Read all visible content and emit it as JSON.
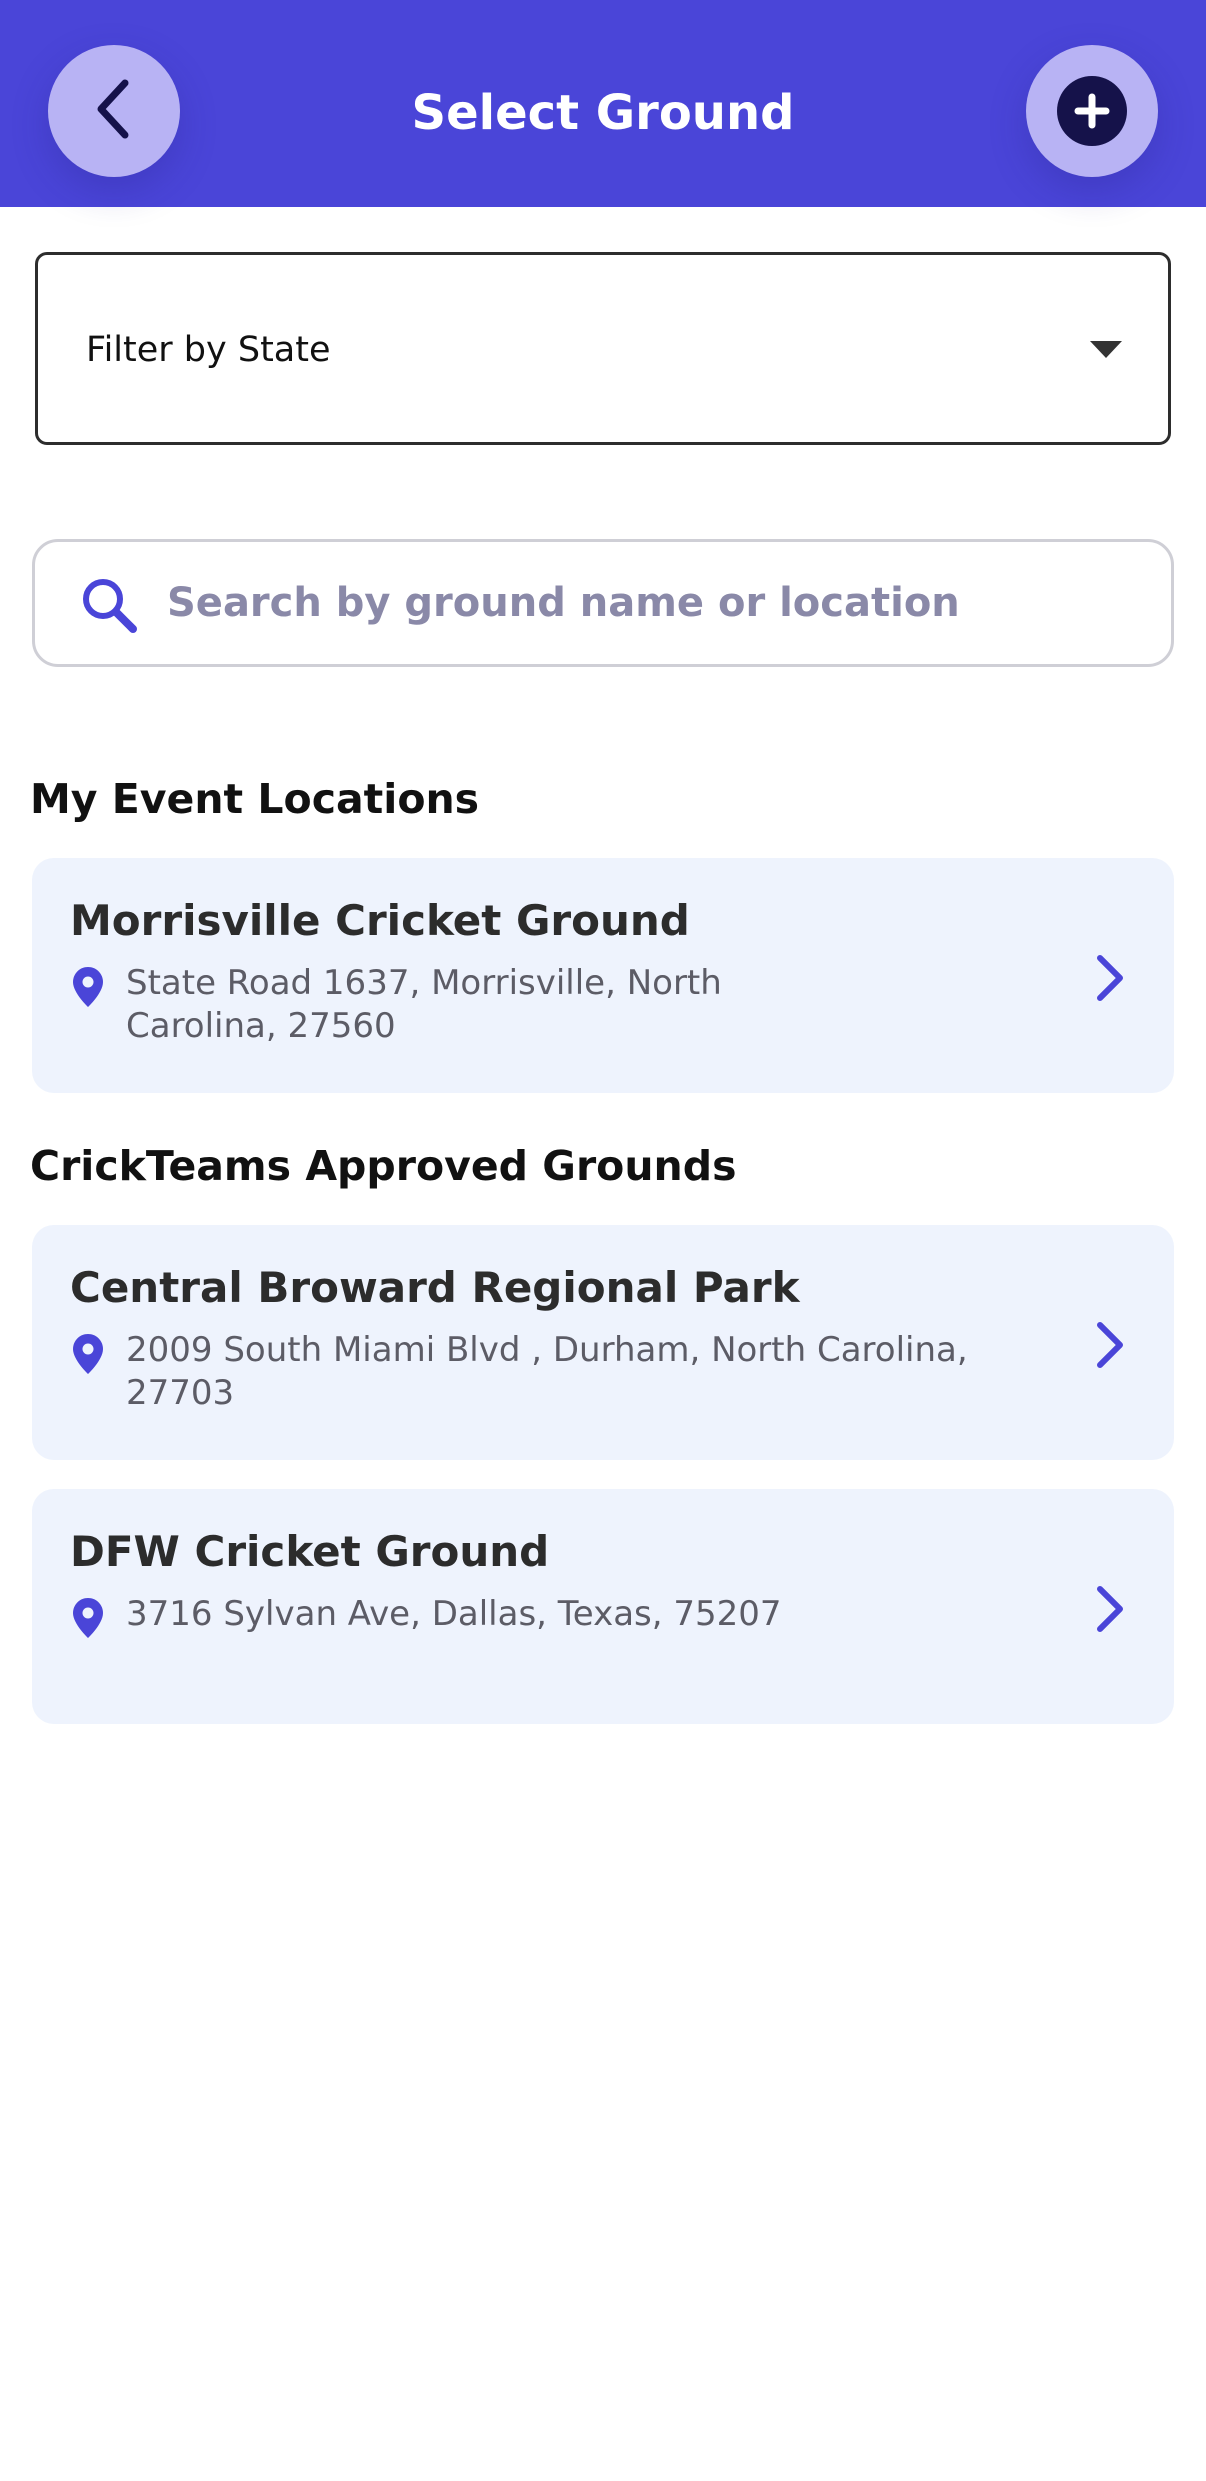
{
  "header": {
    "title": "Select Ground",
    "back_icon": "chevron-left-icon",
    "add_icon": "plus-circle-icon"
  },
  "filter": {
    "label": "Filter by State",
    "icon": "caret-down-icon"
  },
  "search": {
    "placeholder": "Search by ground name or location",
    "value": "",
    "icon": "search-icon"
  },
  "sections": {
    "my_events": {
      "title": "My Event Locations",
      "items": [
        {
          "name": "Morrisville Cricket Ground",
          "address": "State Road 1637, Morrisville, North Carolina, 27560"
        }
      ]
    },
    "approved": {
      "title": "CrickTeams Approved Grounds",
      "items": [
        {
          "name": "Central Broward Regional Park",
          "address": "2009 South Miami Blvd , Durham, North Carolina, 27703"
        },
        {
          "name": "DFW Cricket Ground",
          "address": "3716 Sylvan Ave, Dallas, Texas, 75207"
        }
      ]
    }
  },
  "colors": {
    "header_bg": "#4a45d8",
    "header_button_bg": "#b8b3f4",
    "accent": "#4a45d8",
    "card_bg": "#eef3fd"
  }
}
